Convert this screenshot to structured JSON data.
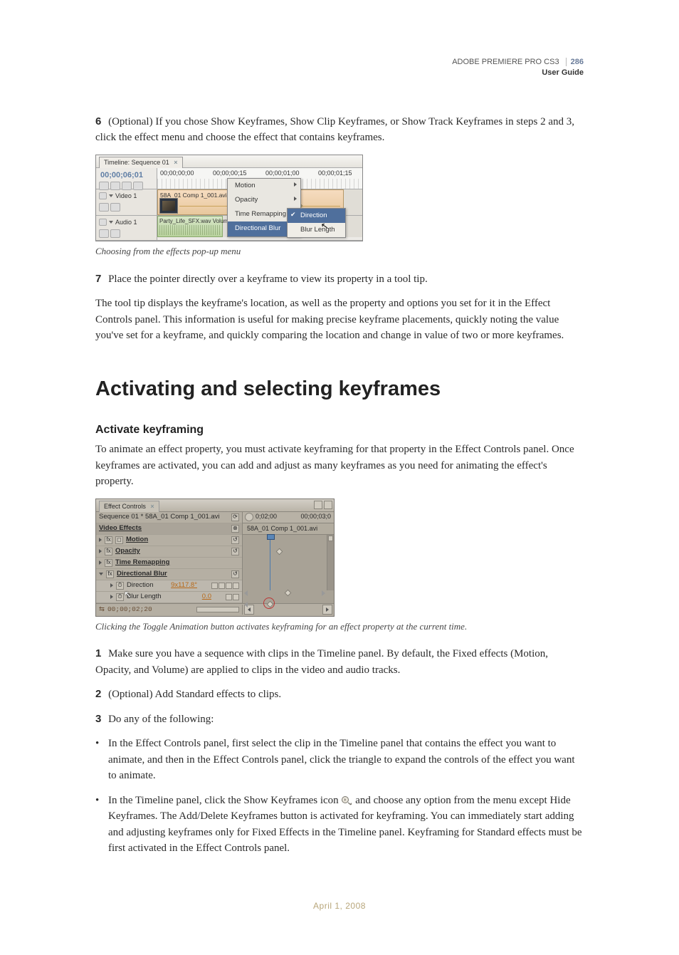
{
  "header": {
    "product": "ADOBE PREMIERE PRO CS3",
    "guide": "User Guide",
    "page_number": "286"
  },
  "body": {
    "step6": {
      "num": "6",
      "text": "(Optional) If you chose Show Keyframes, Show Clip Keyframes, or Show Track Keyframes in steps 2 and 3, click the effect menu and choose the effect that contains keyframes."
    },
    "fig1_caption": "Choosing from the effects pop-up menu",
    "step7": {
      "num": "7",
      "text": "Place the pointer directly over a keyframe to view its property in a tool tip."
    },
    "para_tooltip": "The tool tip displays the keyframe's location, as well as the property and options you set for it in the Effect Controls panel. This information is useful for making precise keyframe placements, quickly noting the value you've set for a keyframe, and quickly comparing the location and change in value of two or more keyframes.",
    "h1": "Activating and selecting keyframes",
    "h2": "Activate keyframing",
    "intro": "To animate an effect property, you must activate keyframing for that property in the Effect Controls panel. Once keyframes are activated, you can add and adjust as many keyframes as you need for animating the effect's property.",
    "fig2_caption": "Clicking the Toggle Animation button activates keyframing for an effect property at the current time.",
    "step1": {
      "num": "1",
      "text": "Make sure you have a sequence with clips in the Timeline panel. By default, the Fixed effects (Motion, Opacity, and Volume) are applied to clips in the video and audio tracks."
    },
    "step2": {
      "num": "2",
      "text": "(Optional) Add Standard effects to clips."
    },
    "step3": {
      "num": "3",
      "text": "Do any of the following:"
    },
    "bullet_a": "In the Effect Controls panel, first select the clip in the Timeline panel that contains the effect you want to animate, and then in the Effect Controls panel, click the triangle to expand the controls of the effect you want to animate.",
    "bullet_b_pre": "In the Timeline panel, click the Show Keyframes icon ",
    "bullet_b_post": " and choose any option from the menu except Hide Keyframes. The Add/Delete Keyframes button is activated for keyframing. You can immediately start adding and adjusting keyframes only for Fixed Effects in the Timeline panel. Keyframing for Standard effects must be first activated in the Effect Controls panel."
  },
  "figure1": {
    "panel_title": "Timeline: Sequence 01",
    "timecode": "00;00;06;01",
    "ruler_labels": [
      "00;00;00;00",
      "00;00;00;15",
      "00;00;01;00",
      "00;00;01;15"
    ],
    "video_track_name": "Video 1",
    "video_clip_label": "58A_01 Comp 1_001.avi Directional Blur:Direction ▾",
    "audio_track_name": "Audio 1",
    "audio_clip_label": "Party_Life_SFX.wav Volum",
    "menu": {
      "items": [
        "Motion",
        "Opacity",
        "Time Remapping",
        "Directional Blur"
      ],
      "highlighted_index": 3,
      "submenu": {
        "items": [
          "Direction",
          "Blur Length"
        ],
        "checked_index": 0,
        "highlighted_index": 0
      }
    }
  },
  "figure2": {
    "panel_title": "Effect Controls",
    "breadcrumb": "Sequence 01 * 58A_01 Comp 1_001.avi",
    "section": "Video Effects",
    "effects": {
      "motion": "Motion",
      "opacity": "Opacity",
      "time_remapping": "Time Remapping",
      "directional_blur": "Directional Blur"
    },
    "props": {
      "direction": {
        "label": "Direction",
        "value": "9x117.8°"
      },
      "blur_length": {
        "label": "Blur Length",
        "value": "0.0"
      }
    },
    "right": {
      "time_start": "0;02;00",
      "time_end": "00;00;03;0",
      "clip_label": "58A_01 Comp 1_001.avi"
    },
    "footer_time": "00;00;02;20"
  },
  "footer_date": "April 1, 2008"
}
